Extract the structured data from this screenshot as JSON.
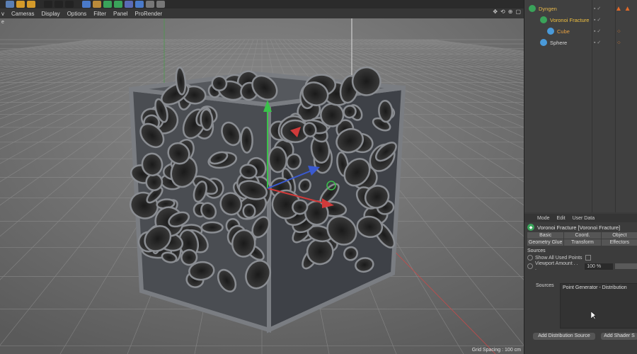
{
  "toolbar": {
    "buttons": [
      {
        "icon": "move-icon",
        "color": "#5a7fb5"
      },
      {
        "icon": "scale-icon",
        "color": "#d49a2a"
      },
      {
        "icon": "rotate-icon",
        "color": "#d49a2a"
      },
      {
        "icon": "film-icon",
        "color": "#222222"
      },
      {
        "icon": "film-icon",
        "color": "#222222"
      },
      {
        "icon": "film-icon",
        "color": "#222222"
      },
      {
        "icon": "cube-icon",
        "color": "#4a7ac9"
      },
      {
        "icon": "pen-icon",
        "color": "#b98a3a"
      },
      {
        "icon": "subdivision-icon",
        "color": "#3aa35a"
      },
      {
        "icon": "cloner-icon",
        "color": "#3aa35a"
      },
      {
        "icon": "deformer-icon",
        "color": "#5a6bb5"
      },
      {
        "icon": "scene-icon",
        "color": "#4a7ac9"
      },
      {
        "icon": "camera-icon",
        "color": "#777777"
      },
      {
        "icon": "light-icon",
        "color": "#777777"
      }
    ]
  },
  "menubar": {
    "items": [
      "v",
      "Cameras",
      "Display",
      "Options",
      "Filter",
      "Panel",
      "ProRender"
    ]
  },
  "viewport": {
    "grid_spacing": "Grid Spacing : 100 cm",
    "label": "e"
  },
  "object_manager": {
    "objects": [
      {
        "name": "Dyngen",
        "icon": "cloner-icon",
        "color": "#3aa35a",
        "text_color": "#e8b84a"
      },
      {
        "name": "Voronoi Fracture",
        "icon": "voronoi-icon",
        "color": "#3aa35a",
        "text_color": "#f0c040"
      },
      {
        "name": "Cube",
        "icon": "cube-icon",
        "color": "#4a9ad9",
        "text_color": "#e8a040"
      },
      {
        "name": "Sphere",
        "icon": "sphere-icon",
        "color": "#4a9ad9",
        "text_color": "#d8d8d8"
      }
    ]
  },
  "attributes": {
    "menu": [
      "Mode",
      "Edit",
      "User Data"
    ],
    "title": "Voronoi Fracture [Voronoi Fracture]",
    "tabs": [
      "Basic",
      "Coord.",
      "Object",
      "Geometry Glue",
      "Transform",
      "Effectors"
    ],
    "section_label": "Sources",
    "show_all_used_points": "Show All Used Points",
    "viewport_amount_label": "Viewport Amount . . .",
    "viewport_amount_value": "100 %",
    "sources_label": "Sources",
    "sources_list_item": "Point Generator - Distribution",
    "add_distribution_button": "Add Distribution Source",
    "add_shader_button": "Add Shader S"
  }
}
